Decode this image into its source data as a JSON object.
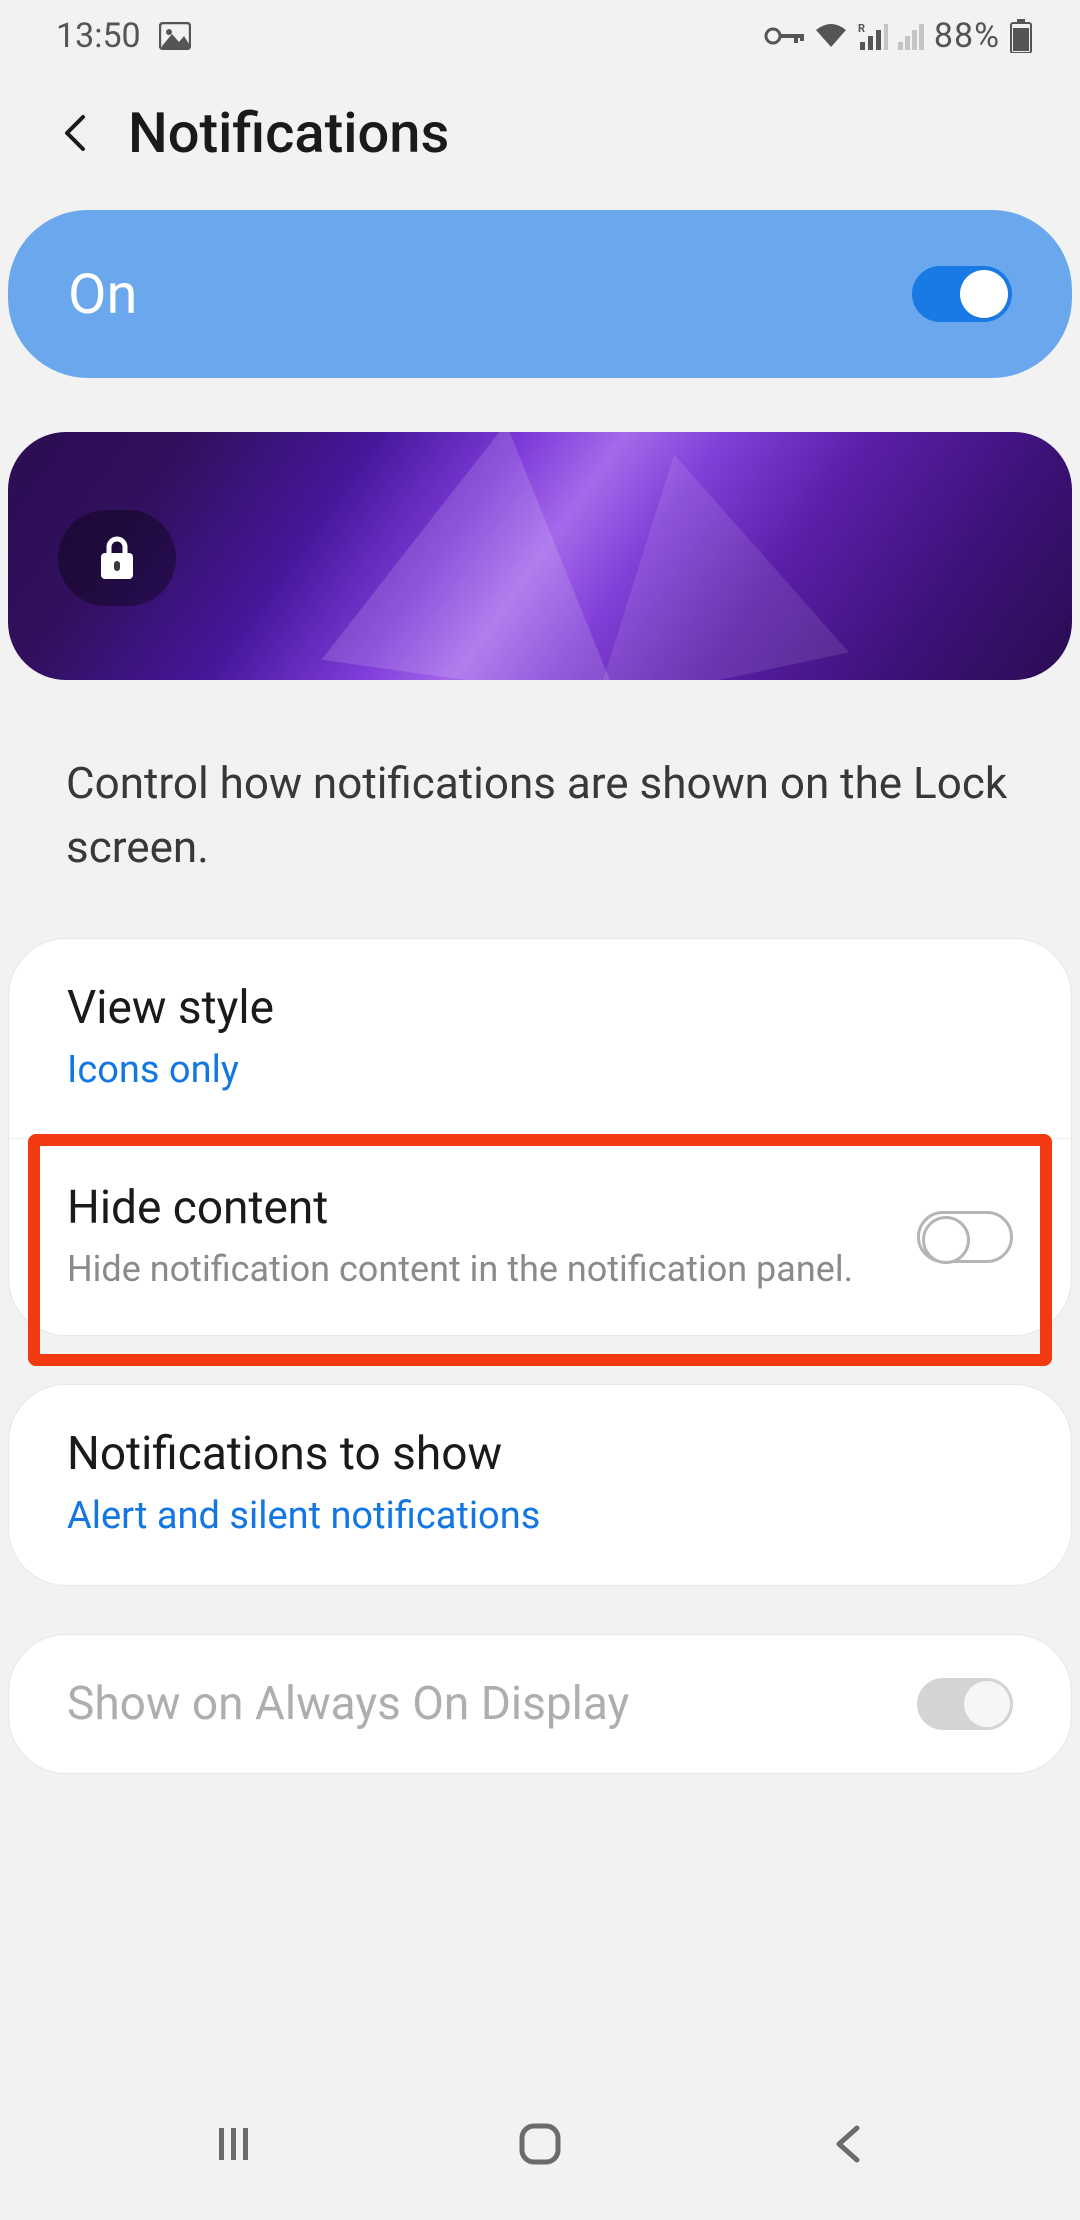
{
  "status_bar": {
    "time": "13:50",
    "battery_text": "88%"
  },
  "header": {
    "title": "Notifications"
  },
  "master": {
    "state_label": "On",
    "enabled": true
  },
  "help_text": "Control how notifications are shown on the Lock screen.",
  "settings": {
    "view_style": {
      "title": "View style",
      "value": "Icons only"
    },
    "hide_content": {
      "title": "Hide content",
      "description": "Hide notification content in the notification panel.",
      "enabled": false
    },
    "notifications_to_show": {
      "title": "Notifications to show",
      "value": "Alert and silent notifications"
    },
    "always_on_display": {
      "title": "Show on Always On Display",
      "enabled": false,
      "row_enabled": false
    }
  },
  "highlight": {
    "target": "hide-content-row"
  }
}
